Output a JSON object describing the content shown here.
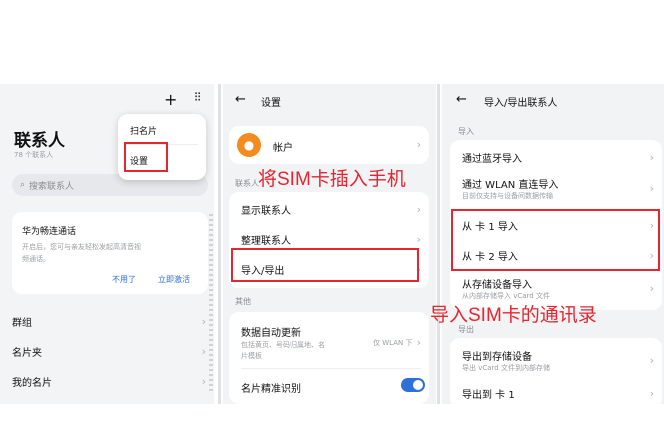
{
  "panel1": {
    "plus_icon": "plus-icon",
    "more_icon": "grid-dots-icon",
    "title": "联系人",
    "count": "78 个联系人",
    "search_placeholder": "搜索联系人",
    "menu": {
      "scan": "扫名片",
      "settings": "设置"
    },
    "promo": {
      "title": "华为畅连通话",
      "text_line1": "开启后，您可与亲友轻松发起高清音视",
      "text_line2": "频通话。",
      "btn_no": "不用了",
      "btn_activate": "立即激活"
    },
    "list": [
      "群组",
      "名片夹",
      "我的名片"
    ]
  },
  "panel2": {
    "title": "设置",
    "account": "帐户",
    "section_contacts": "联系人",
    "items": [
      "显示联系人",
      "整理联系人",
      "导入/导出"
    ],
    "section_other": "其他",
    "auto_update": "数据自动更新",
    "auto_update_desc1": "包括黄页、号码归属地、名",
    "auto_update_desc2": "片模板",
    "auto_update_value": "仅 WLAN 下",
    "card_recognition": "名片精准识别",
    "toggle_on": true
  },
  "panel3": {
    "title": "导入/导出联系人",
    "section_import": "导入",
    "import_items": [
      {
        "label": "通过蓝牙导入"
      },
      {
        "label": "通过 WLAN 直连导入",
        "desc": "目前仅支持与设备间数据传输"
      },
      {
        "label": "从 卡 1 导入"
      },
      {
        "label": "从 卡 2 导入"
      },
      {
        "label": "从存储设备导入",
        "desc": "从内部存储导入 vCard 文件"
      }
    ],
    "section_export": "导出",
    "export_items": [
      {
        "label": "导出到存储设备",
        "desc": "导出 vCard 文件到内部存储"
      },
      {
        "label": "导出到 卡 1"
      }
    ]
  },
  "annotations": {
    "insert_sim": "将SIM卡插入手机",
    "import_sim": "导入SIM卡的通讯录"
  },
  "colors": {
    "accent_red": "#e3262f",
    "blue": "#2f6fd8",
    "avatar": "#f58a1f",
    "toggle": "#2f6fd8"
  }
}
